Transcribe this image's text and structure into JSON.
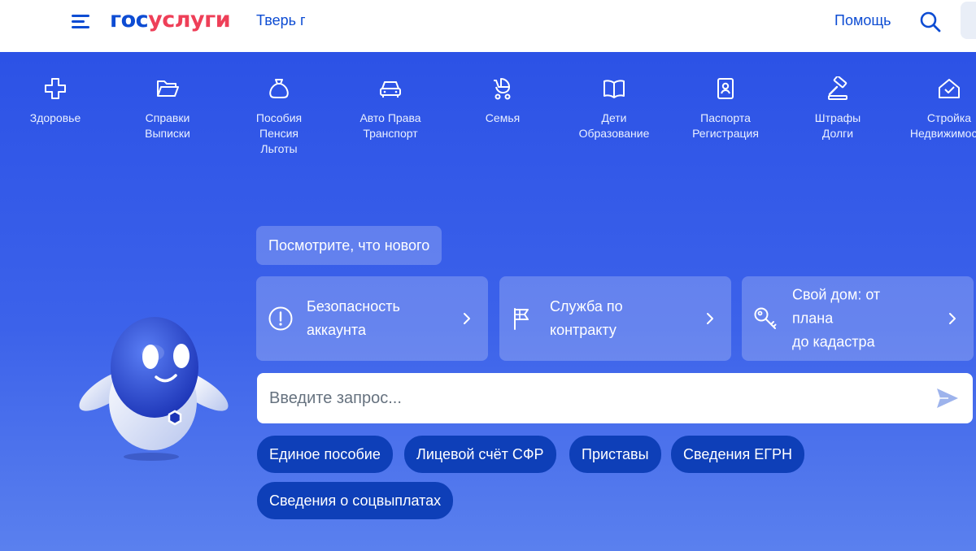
{
  "header": {
    "logo_part1": "гос",
    "logo_part2": "услуги",
    "city": "Тверь г",
    "help": "Помощь"
  },
  "categories": [
    {
      "icon": "health-cross-icon",
      "lines": [
        "Здоровье"
      ]
    },
    {
      "icon": "folder-icon",
      "lines": [
        "Справки",
        "Выписки"
      ]
    },
    {
      "icon": "money-bag-icon",
      "lines": [
        "Пособия",
        "Пенсия",
        "Льготы"
      ]
    },
    {
      "icon": "car-icon",
      "lines": [
        "Авто Права",
        "Транспорт"
      ]
    },
    {
      "icon": "stroller-icon",
      "lines": [
        "Семья"
      ]
    },
    {
      "icon": "book-icon",
      "lines": [
        "Дети",
        "Образование"
      ]
    },
    {
      "icon": "passport-icon",
      "lines": [
        "Паспорта",
        "Регистрация"
      ]
    },
    {
      "icon": "gavel-icon",
      "lines": [
        "Штрафы",
        "Долги"
      ]
    },
    {
      "icon": "house-check-icon",
      "lines": [
        "Стройка",
        "Недвижимость"
      ]
    }
  ],
  "whats_new": "Посмотрите, что нового",
  "cards": [
    {
      "icon": "exclamation-circle-icon",
      "lines": [
        "Безопасность",
        "аккаунта"
      ]
    },
    {
      "icon": "flag-icon",
      "lines": [
        "Служба по",
        "контракту"
      ]
    },
    {
      "icon": "key-icon",
      "lines": [
        "Свой дом: от",
        "плана",
        "до кадастра"
      ]
    }
  ],
  "search": {
    "placeholder": "Введите запрос..."
  },
  "chips": [
    "Единое пособие",
    "Лицевой счёт СФР",
    "Приставы",
    "Сведения ЕГРН",
    "Сведения о соцвыплатах"
  ],
  "colors": {
    "brand_blue": "#0d4cd3",
    "brand_red": "#ee3f58",
    "hero_blue": "#2c52e6",
    "chip_blue": "#0e3fb8"
  }
}
